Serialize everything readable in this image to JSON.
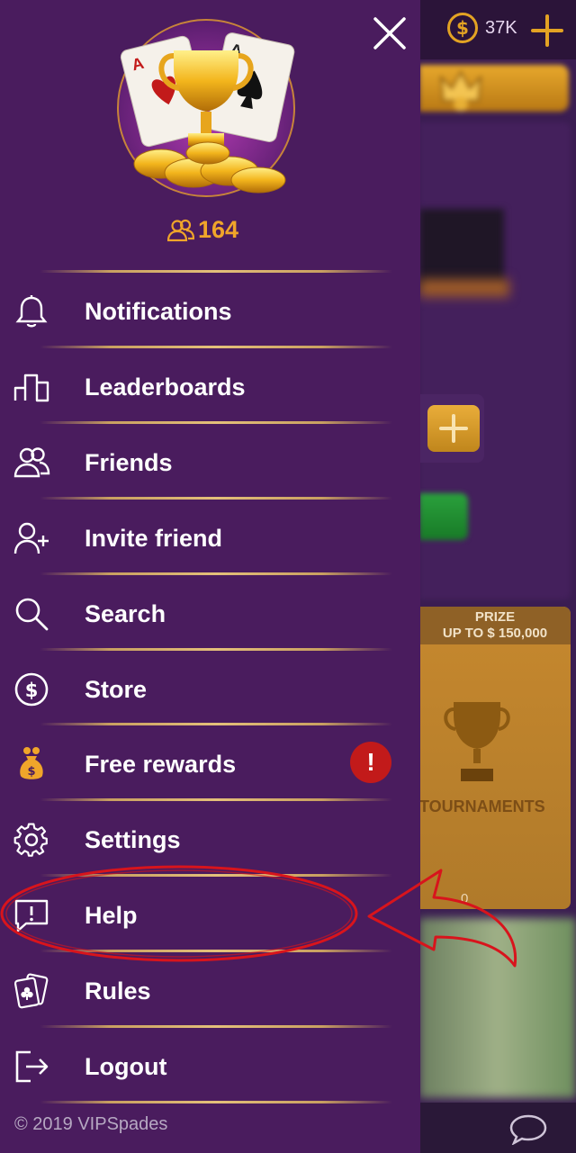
{
  "background": {
    "coin_symbol": "$",
    "coin_balance": "37K",
    "prize_label": "PRIZE",
    "prize_amount": "UP TO $ 150,000",
    "tournaments_label": "TOURNAMENTS",
    "tournament_players": "0"
  },
  "drawer": {
    "friends_count": "164",
    "menu": [
      {
        "label": "Notifications",
        "icon": "bell-icon"
      },
      {
        "label": "Leaderboards",
        "icon": "leaderboard-icon"
      },
      {
        "label": "Friends",
        "icon": "friends-icon"
      },
      {
        "label": "Invite friend",
        "icon": "add-user-icon"
      },
      {
        "label": "Search",
        "icon": "search-icon"
      },
      {
        "label": "Store",
        "icon": "dollar-coin-icon"
      },
      {
        "label": "Free rewards",
        "icon": "money-bag-icon"
      },
      {
        "label": "Settings",
        "icon": "gear-icon"
      },
      {
        "label": "Help",
        "icon": "feedback-icon"
      },
      {
        "label": "Rules",
        "icon": "cards-icon"
      },
      {
        "label": "Logout",
        "icon": "logout-icon"
      }
    ],
    "alert_badge": "!",
    "copyright": "©  2019 VIPSpades"
  },
  "colors": {
    "drawer_bg": "#4a1c5e",
    "accent_gold": "#f0a52a",
    "alert_red": "#c21a1a",
    "annotation_red": "#d8141c"
  }
}
